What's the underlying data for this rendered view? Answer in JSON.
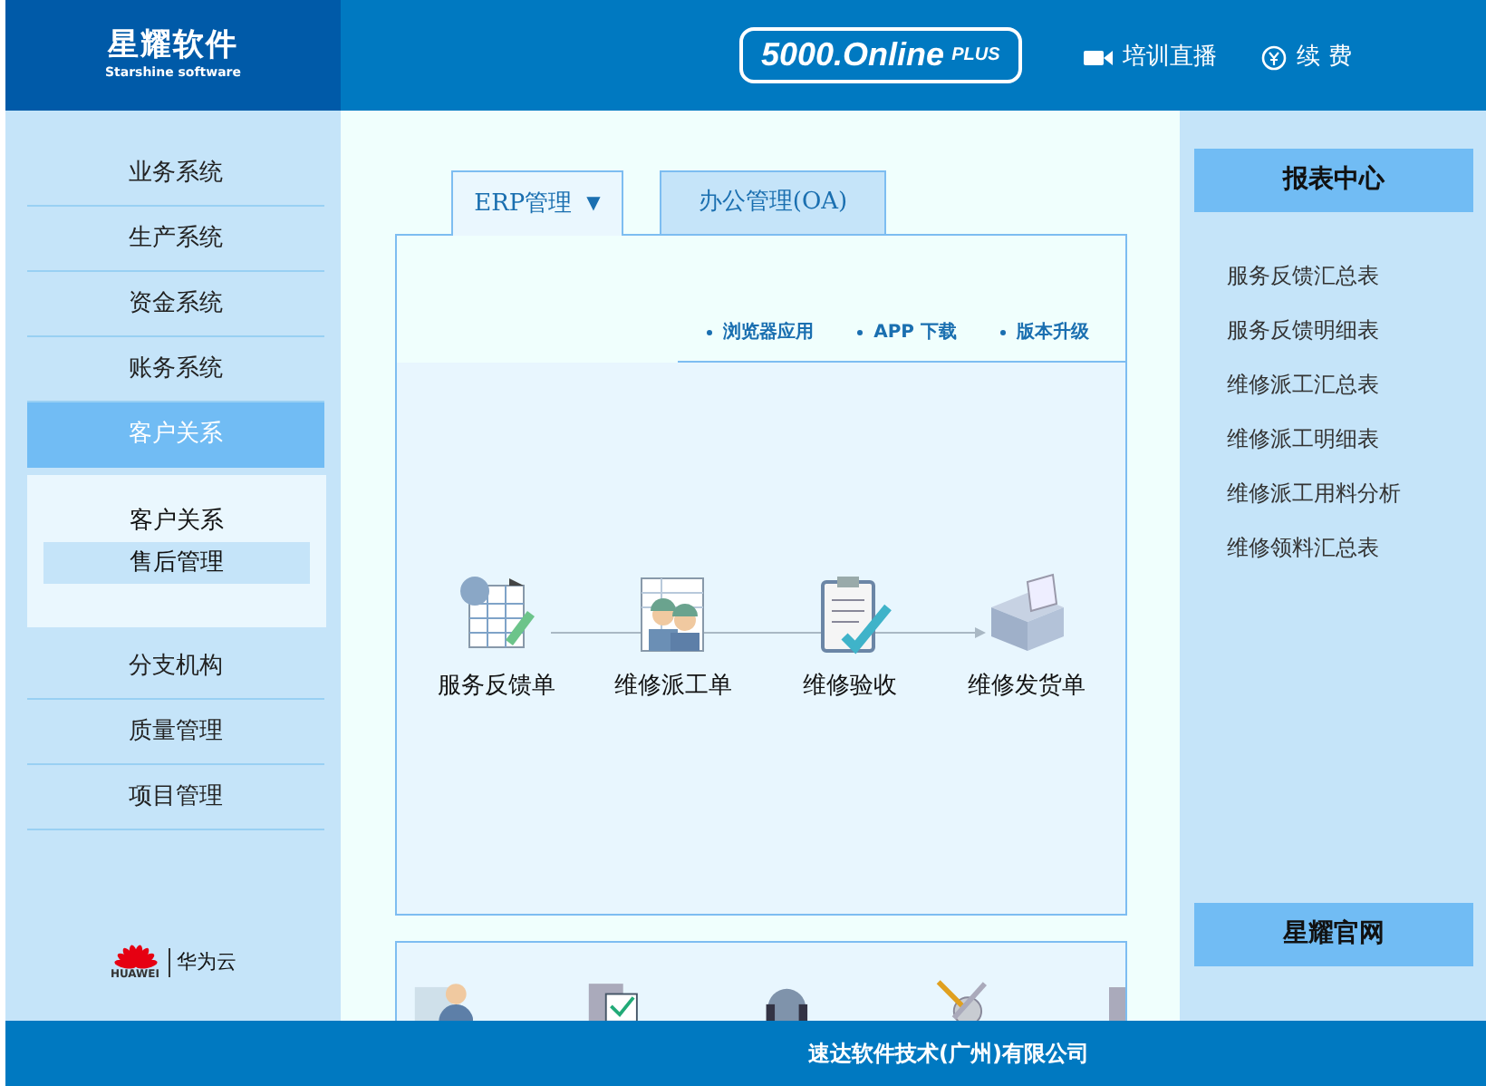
{
  "header": {
    "brand_title": "星耀软件",
    "brand_subtitle": "Starshine software",
    "product": {
      "name": "5000.Online",
      "edition": "PLUS"
    },
    "links": [
      {
        "kind": "video",
        "label": "培训直播"
      },
      {
        "kind": "renew",
        "label": "续 费"
      }
    ]
  },
  "sidebar": {
    "items": [
      {
        "label": "业务系统",
        "selected": false
      },
      {
        "label": "生产系统",
        "selected": false
      },
      {
        "label": "资金系统",
        "selected": false
      },
      {
        "label": "账务系统",
        "selected": false
      },
      {
        "label": "客户关系",
        "selected": true,
        "expanded": true,
        "children": [
          {
            "label": "客户关系",
            "selected": false
          },
          {
            "label": "售后管理",
            "selected": true
          }
        ]
      },
      {
        "label": "分支机构",
        "selected": false
      },
      {
        "label": "质量管理",
        "selected": false
      },
      {
        "label": "项目管理",
        "selected": false
      }
    ],
    "partner": {
      "logo_text": "HUAWEI",
      "name": "华为云"
    }
  },
  "tabs": [
    {
      "label": "ERP管理",
      "caret": "▼",
      "selected": true
    },
    {
      "label": "办公管理(OA)",
      "selected": false
    }
  ],
  "quick_links": [
    "浏览器应用",
    "APP 下载",
    "版本升级"
  ],
  "workflow": [
    {
      "kind": "form",
      "label": "服务反馈单"
    },
    {
      "kind": "workers",
      "label": "维修派工单"
    },
    {
      "kind": "clipboard",
      "label": "维修验收"
    },
    {
      "kind": "box",
      "label": "维修发货单"
    }
  ],
  "lower_panel_icons": [
    {
      "kind": "person"
    },
    {
      "kind": "checkbox"
    },
    {
      "kind": "headset"
    },
    {
      "kind": "tools"
    },
    {
      "kind": "device"
    }
  ],
  "report_center": {
    "title": "报表中心",
    "items": [
      "服务反馈汇总表",
      "服务反馈明细表",
      "维修派工汇总表",
      "维修派工明细表",
      "维修派工用料分析",
      "维修领料汇总表"
    ],
    "website_button": "星耀官网"
  },
  "footer": {
    "company": "速达软件技术(广州)有限公司"
  }
}
